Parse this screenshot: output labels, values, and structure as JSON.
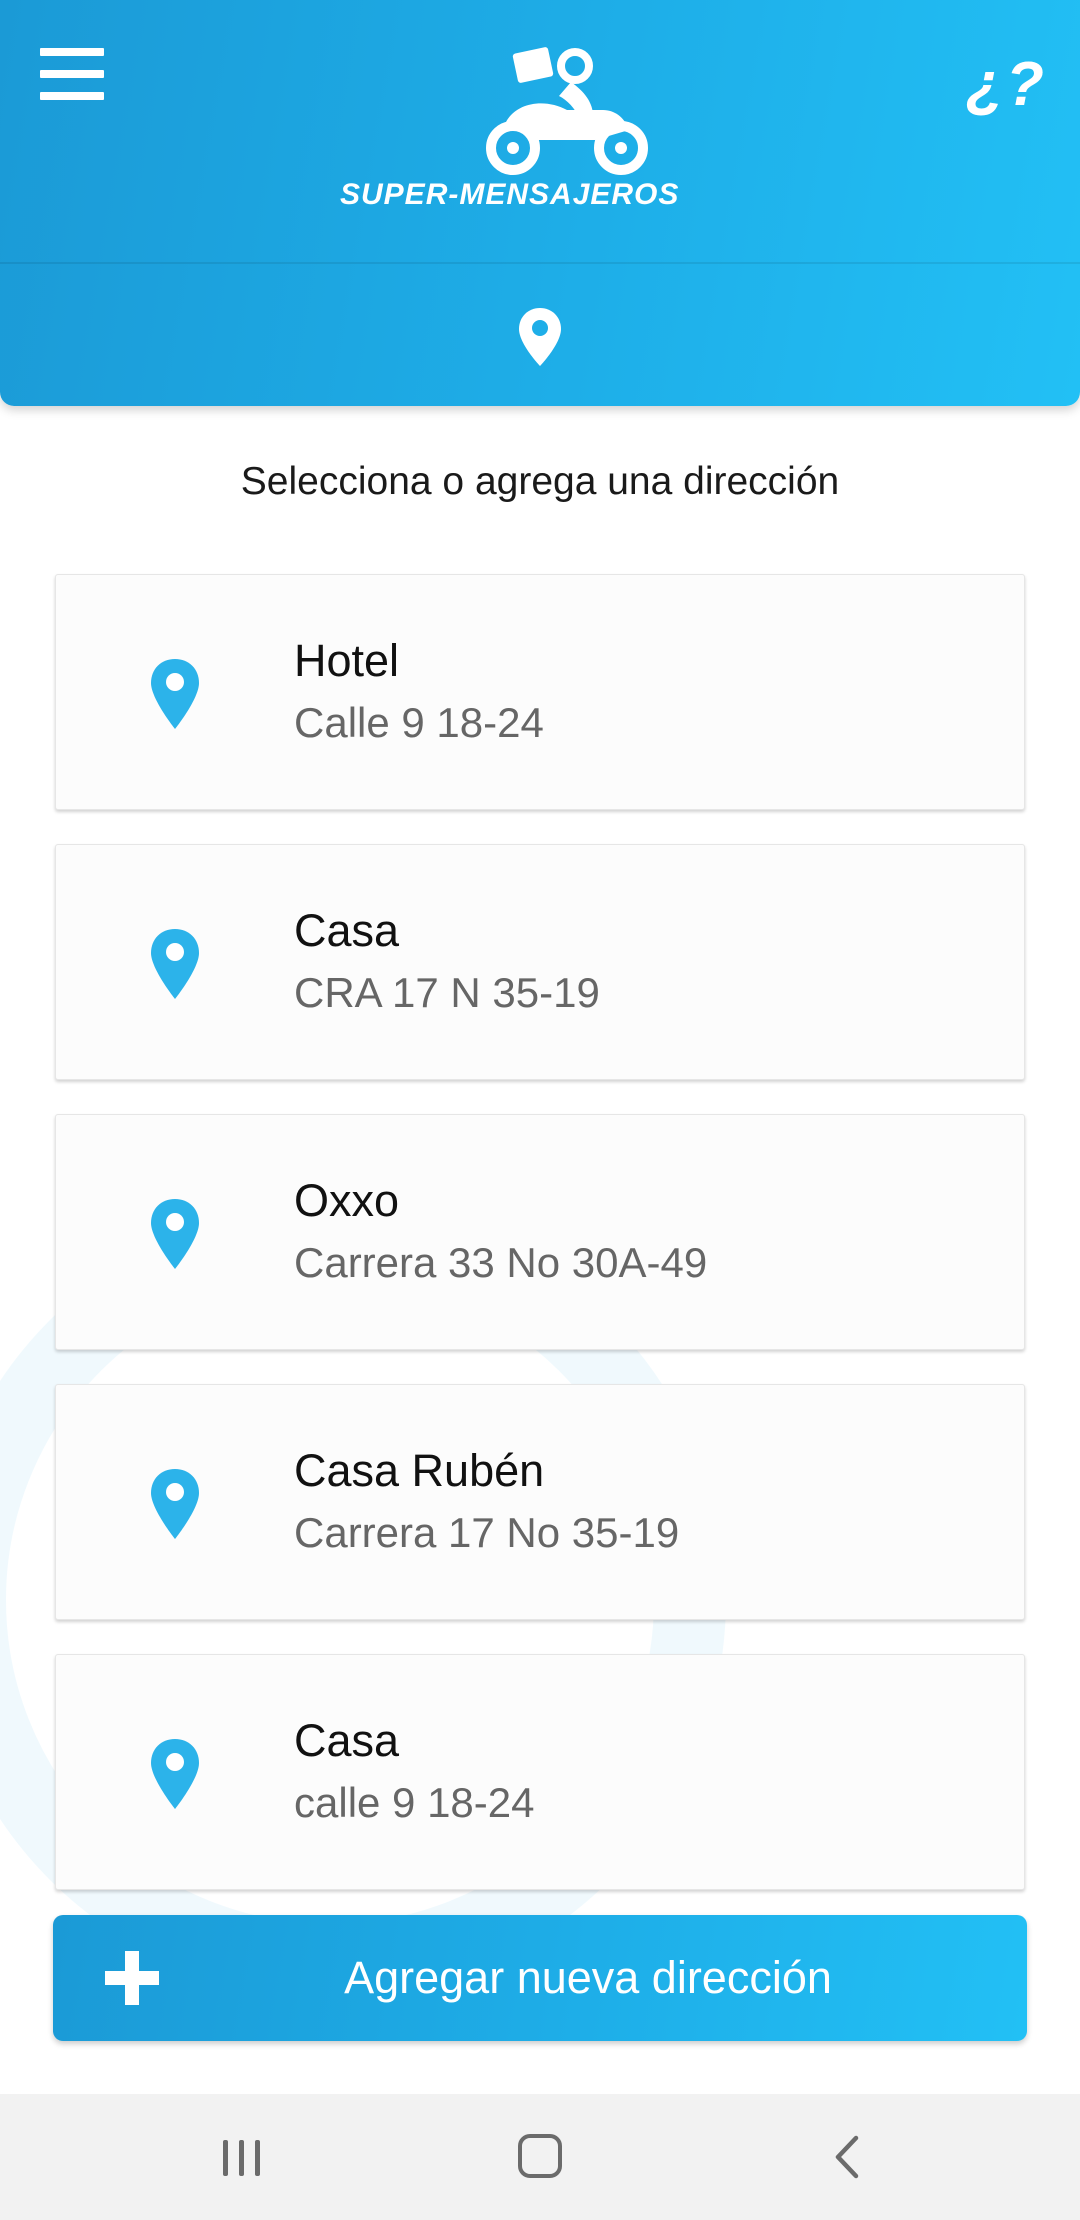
{
  "header": {
    "brand_name": "SUPER-MENSAJEROS",
    "help_label": "¿?",
    "menu_icon": "hamburger-menu-icon",
    "location_icon": "map-pin-icon",
    "brand_color": "#1eaee8"
  },
  "subtitle": "Selecciona o agrega una dirección",
  "addresses": [
    {
      "name": "Hotel",
      "street": "Calle 9 18-24"
    },
    {
      "name": "Casa",
      "street": "CRA 17 N 35-19"
    },
    {
      "name": "Oxxo",
      "street": "Carrera 33 No 30A-49"
    },
    {
      "name": "Casa Rubén",
      "street": "Carrera 17 No 35-19"
    },
    {
      "name": "Casa",
      "street": "calle 9 18-24"
    }
  ],
  "add_button": {
    "label": "Agregar nueva dirección",
    "icon": "plus-icon"
  },
  "colors": {
    "accent": "#1eaee8",
    "pin": "#2cb3ea",
    "card_background": "#fcfcfc",
    "nav_background": "#f2f2f2"
  },
  "nav_bar": {
    "recents_icon": "recents-icon",
    "home_icon": "home-icon",
    "back_icon": "back-icon"
  }
}
